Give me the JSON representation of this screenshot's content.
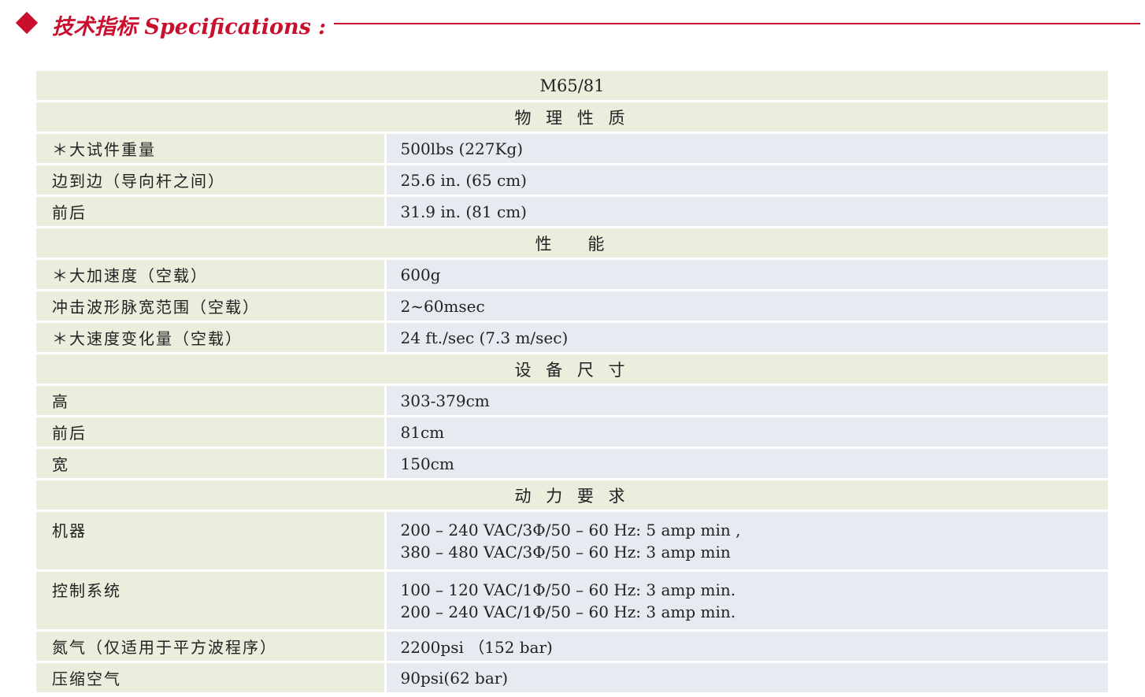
{
  "header": {
    "title": "技术指标 Specifications :"
  },
  "table": {
    "model": "M65/81",
    "sections": [
      {
        "title": "物 理 性 质",
        "rows": [
          {
            "label": "＊大试件重量",
            "values": [
              "500lbs (227Kg)"
            ]
          },
          {
            "label": "边到边（导向杆之间）",
            "values": [
              "25.6 in. (65 cm)"
            ]
          },
          {
            "label": "前后",
            "values": [
              "31.9 in. (81 cm)"
            ]
          }
        ]
      },
      {
        "title": "性　 能",
        "rows": [
          {
            "label": "＊大加速度（空载）",
            "values": [
              "600g"
            ]
          },
          {
            "label": "冲击波形脉宽范围（空载）",
            "values": [
              "2~60msec"
            ]
          },
          {
            "label": "＊大速度变化量（空载）",
            "values": [
              "24 ft./sec (7.3 m/sec)"
            ]
          }
        ]
      },
      {
        "title": "设 备 尺 寸",
        "rows": [
          {
            "label": "高",
            "values": [
              "303-379cm"
            ]
          },
          {
            "label": "前后",
            "values": [
              "81cm"
            ]
          },
          {
            "label": "宽",
            "values": [
              "150cm"
            ]
          }
        ]
      },
      {
        "title": "动 力 要 求",
        "rows": [
          {
            "label": "机器",
            "values": [
              "200 – 240 VAC/3Φ/50 – 60 Hz: 5 amp min ,",
              "380 – 480 VAC/3Φ/50 – 60 Hz: 3 amp min"
            ]
          },
          {
            "label": "控制系统",
            "values": [
              "100 – 120 VAC/1Φ/50 – 60 Hz: 3 amp min.",
              "200 – 240 VAC/1Φ/50 – 60 Hz: 3 amp min."
            ]
          },
          {
            "label": "氮气（仅适用于平方波程序）",
            "values": [
              "2200psi （152 bar)"
            ]
          },
          {
            "label": "压缩空气",
            "values": [
              "90psi(62 bar)"
            ]
          }
        ]
      }
    ]
  },
  "colors": {
    "accent": "#c8102e",
    "label_bg": "#e9eedd",
    "value_bg": "#e6ebf2"
  }
}
